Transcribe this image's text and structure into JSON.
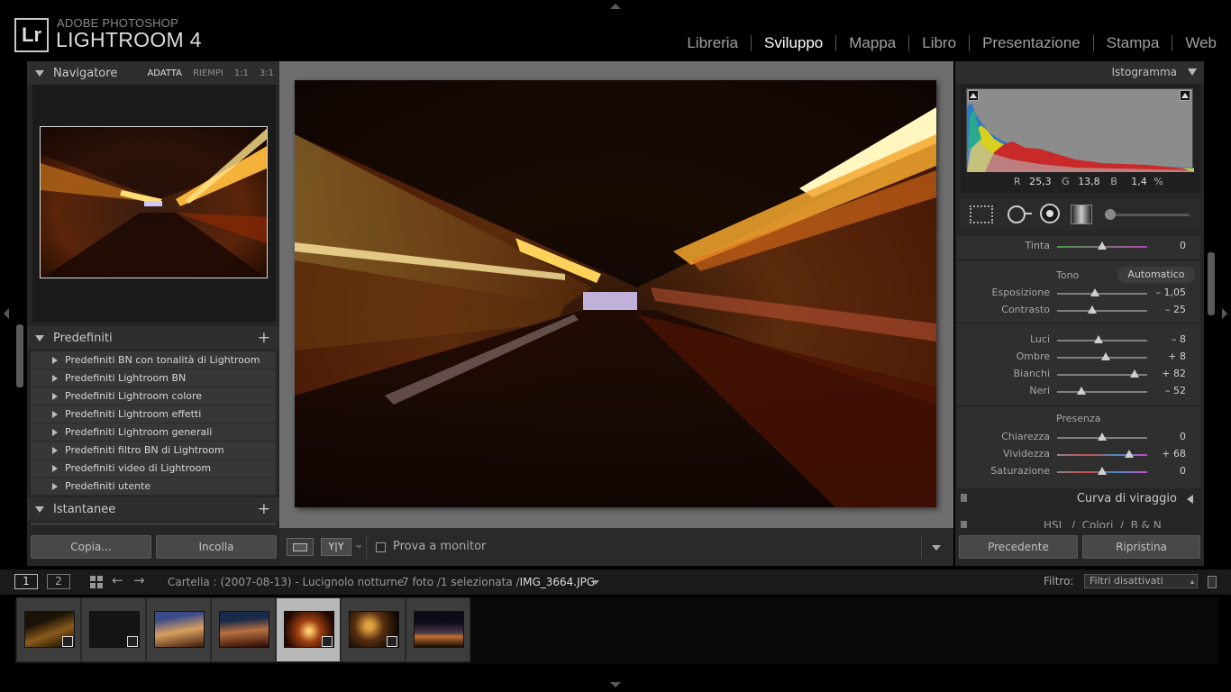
{
  "brand": {
    "logo": "Lr",
    "subtitle": "ADOBE PHOTOSHOP",
    "name": "LIGHTROOM 4"
  },
  "modules": [
    "Libreria",
    "Sviluppo",
    "Mappa",
    "Libro",
    "Presentazione",
    "Stampa",
    "Web"
  ],
  "active_module": "Sviluppo",
  "left_panel": {
    "navigator": {
      "title": "Navigatore",
      "options": [
        "ADATTA",
        "RIEMPI",
        "1:1",
        "3:1"
      ],
      "active_option": "ADATTA"
    },
    "presets": {
      "title": "Predefiniti",
      "items": [
        "Predefiniti BN con tonalità di Lightroom",
        "Predefiniti Lightroom BN",
        "Predefiniti Lightroom colore",
        "Predefiniti Lightroom effetti",
        "Predefiniti Lightroom generali",
        "Predefiniti filtro BN di Lightroom",
        "Predefiniti video di Lightroom",
        "Predefiniti utente"
      ]
    },
    "snapshots": {
      "title": "Istantanee"
    },
    "copy_label": "Copia...",
    "paste_label": "Incolla"
  },
  "toolbar": {
    "softproof_label": "Prova a monitor",
    "yy_label": "Y|Y"
  },
  "right_panel": {
    "histogram": {
      "title": "Istogramma",
      "readout": {
        "r_label": "R",
        "r": "25,3",
        "g_label": "G",
        "g": "13,8",
        "b_label": "B",
        "b": "1,4",
        "unit": "%"
      }
    },
    "basic": {
      "tint": {
        "label": "Tinta",
        "value": "0",
        "pos": 0.5
      },
      "tone_label": "Tono",
      "auto_label": "Automatico",
      "tone_sliders": [
        {
          "label": "Esposizione",
          "value": "– 1,05",
          "pos": 0.42
        },
        {
          "label": "Contrasto",
          "value": "– 25",
          "pos": 0.39
        }
      ],
      "light_sliders": [
        {
          "label": "Luci",
          "value": "– 8",
          "pos": 0.46
        },
        {
          "label": "Ombre",
          "value": "+ 8",
          "pos": 0.54
        },
        {
          "label": "Bianchi",
          "value": "+ 82",
          "pos": 0.86
        },
        {
          "label": "Neri",
          "value": "– 52",
          "pos": 0.27
        }
      ],
      "presence_label": "Presenza",
      "presence_sliders": [
        {
          "label": "Chiarezza",
          "value": "0",
          "pos": 0.5
        },
        {
          "label": "Vividezza",
          "value": "+ 68",
          "pos": 0.8
        },
        {
          "label": "Saturazione",
          "value": "0",
          "pos": 0.5
        }
      ]
    },
    "tone_curve_label": "Curva di viraggio",
    "hsl_label": "HSL  /  Colori  /  B & N",
    "previous_label": "Precedente",
    "reset_label": "Ripristina"
  },
  "filmbar": {
    "page1": "1",
    "page2": "2",
    "folder": "Cartella : (2007-08-13) - Lucignolo notturne",
    "count": "7 foto /1 selezionata /",
    "filename": "IMG_3664.JPG",
    "filter_label": "Filtro:",
    "filter_value": "Filtri disattivati"
  },
  "colors": {
    "accent_bg": "#262626",
    "slider_knob": "#cfcfcf"
  }
}
